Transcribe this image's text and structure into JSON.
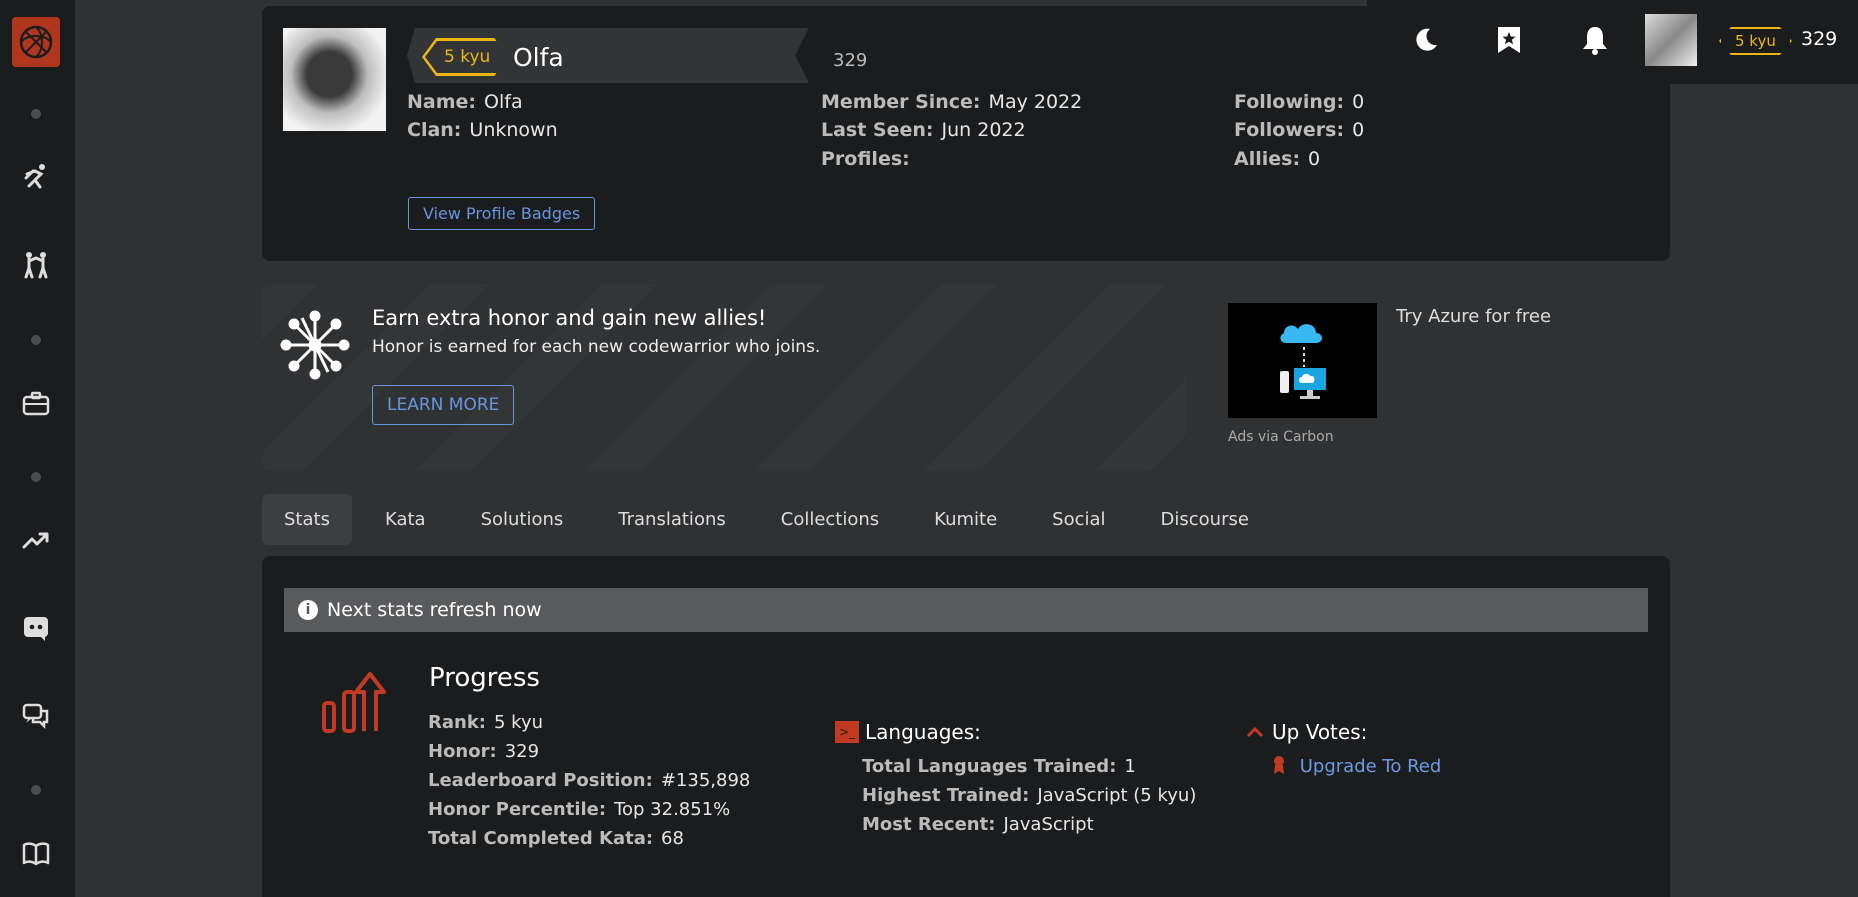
{
  "sidebar": {
    "items": [
      {
        "icon": "training-icon"
      },
      {
        "icon": "kumite-icon"
      },
      {
        "icon": "briefcase-icon"
      },
      {
        "icon": "leaderboard-trend-icon"
      },
      {
        "icon": "discord-icon"
      },
      {
        "icon": "forum-chat-icon"
      },
      {
        "icon": "docs-book-icon"
      }
    ]
  },
  "topbar": {
    "rank": "5 kyu",
    "honor": "329"
  },
  "profile": {
    "rank": "5 kyu",
    "username": "Olfa",
    "honor": "329",
    "name_label": "Name:",
    "name_value": "Olfa",
    "clan_label": "Clan:",
    "clan_value": "Unknown",
    "member_since_label": "Member Since:",
    "member_since_value": "May 2022",
    "last_seen_label": "Last Seen:",
    "last_seen_value": "Jun 2022",
    "profiles_label": "Profiles:",
    "following_label": "Following:",
    "following_value": "0",
    "followers_label": "Followers:",
    "followers_value": "0",
    "allies_label": "Allies:",
    "allies_value": "0",
    "badges_button": "View Profile Badges"
  },
  "honor_banner": {
    "title": "Earn extra honor and gain new allies!",
    "subtitle": "Honor is earned for each new codewarrior who joins.",
    "button": "LEARN MORE"
  },
  "ad": {
    "text": "Try Azure for free",
    "via": "Ads via Carbon"
  },
  "tabs": [
    "Stats",
    "Kata",
    "Solutions",
    "Translations",
    "Collections",
    "Kumite",
    "Social",
    "Discourse"
  ],
  "active_tab": "Stats",
  "stats": {
    "refresh": "Next stats refresh now",
    "progress_title": "Progress",
    "rank_label": "Rank:",
    "rank_value": "5 kyu",
    "honor_label": "Honor:",
    "honor_value": "329",
    "leaderboard_label": "Leaderboard Position:",
    "leaderboard_value": "#135,898",
    "percentile_label": "Honor Percentile:",
    "percentile_value": "Top 32.851%",
    "completed_label": "Total Completed Kata:",
    "completed_value": "68",
    "languages_title": "Languages:",
    "total_lang_label": "Total Languages Trained:",
    "total_lang_value": "1",
    "highest_label": "Highest Trained:",
    "highest_value": "JavaScript (5 kyu)",
    "recent_label": "Most Recent:",
    "recent_value": "JavaScript",
    "upvotes_title": "Up Votes:",
    "upgrade_link": "Upgrade To Red"
  },
  "colors": {
    "accent": "#b1361e",
    "rank": "#ecb613",
    "link": "#6795de",
    "panel": "#1b1c1e",
    "background": "#303133"
  }
}
